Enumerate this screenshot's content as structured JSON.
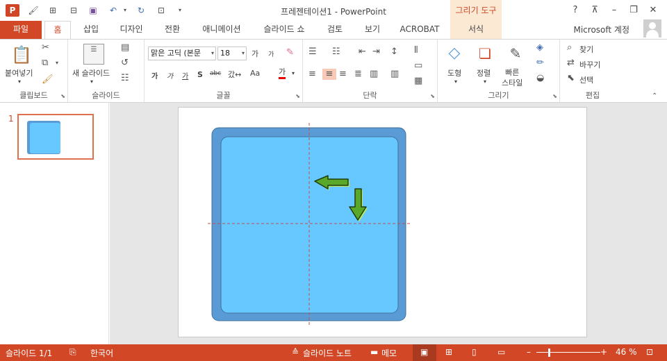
{
  "title_bar": {
    "app_logo": "P",
    "window_title": "프레젠테이션1 - PowerPoint",
    "contextual_tab_group": "그리기 도구",
    "help": "?",
    "qat_icons": [
      "save-icon",
      "undo-icon",
      "redo-icon",
      "start-from-beginning-icon",
      "customize-qat-icon"
    ]
  },
  "tabs": {
    "file": "파일",
    "items": [
      "홈",
      "삽입",
      "디자인",
      "전환",
      "애니메이션",
      "슬라이드 쇼",
      "검토",
      "보기",
      "ACROBAT",
      "서식"
    ],
    "active": "홈",
    "account": "Microsoft 계정"
  },
  "ribbon": {
    "clipboard": {
      "paste": "붙여넣기",
      "label": "클립보드"
    },
    "slides": {
      "new_slide": "새 슬라이드",
      "label": "슬라이드"
    },
    "font": {
      "font_name": "맑은 고딕 (본문",
      "font_size": "18",
      "grow": "가",
      "shrink": "가",
      "bold": "가",
      "italic": "가",
      "underline": "가",
      "shadow": "S",
      "strike": "abc",
      "spacing": "갔↔",
      "case": "Aa",
      "color": "가",
      "label": "글꼴"
    },
    "paragraph": {
      "label": "단락"
    },
    "drawing": {
      "shapes": "도형",
      "arrange": "정렬",
      "quick_styles": "빠른\n스타일",
      "label": "그리기"
    },
    "editing": {
      "find": "찾기",
      "replace": "바꾸기",
      "select": "선택",
      "label": "편집"
    }
  },
  "thumbnails": {
    "slide_number": "1"
  },
  "status_bar": {
    "slide_info": "슬라이드 1/1",
    "language": "한국어",
    "notes": "슬라이드 노트",
    "comments": "메모",
    "zoom": "46 %",
    "zoom_level": 0.46
  },
  "colors": {
    "accent": "#d24726",
    "shape_outer": "#5b9bd5",
    "shape_inner": "#66c8ff",
    "arrow_fill": "#5aa82a",
    "arrow_glow": "#b8e86a",
    "guide": "#c0504d"
  }
}
